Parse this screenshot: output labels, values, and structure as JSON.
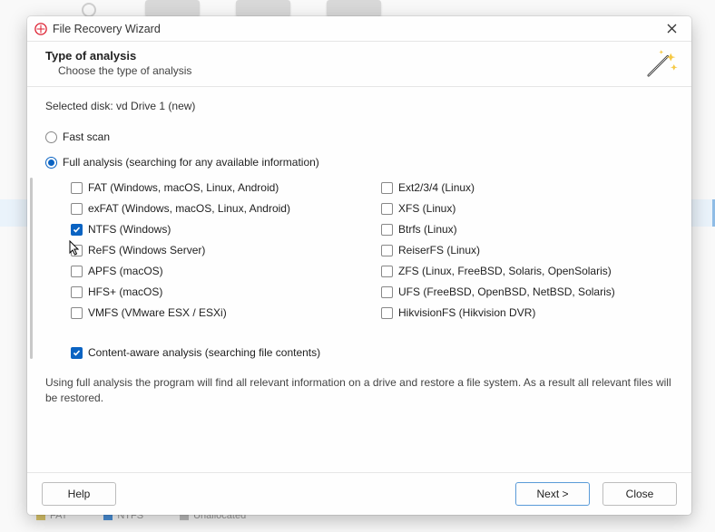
{
  "window": {
    "title": "File Recovery Wizard"
  },
  "header": {
    "title": "Type of analysis",
    "subtitle": "Choose the type of analysis"
  },
  "selected_disk_label": "Selected disk: vd Drive 1 (new)",
  "scan_modes": {
    "fast": {
      "label": "Fast scan",
      "selected": false
    },
    "full": {
      "label": "Full analysis (searching for any available information)",
      "selected": true
    }
  },
  "filesystems": {
    "left": [
      {
        "id": "fat",
        "label": "FAT (Windows, macOS, Linux, Android)",
        "checked": false
      },
      {
        "id": "exfat",
        "label": "exFAT (Windows, macOS, Linux, Android)",
        "checked": false
      },
      {
        "id": "ntfs",
        "label": "NTFS (Windows)",
        "checked": true
      },
      {
        "id": "refs",
        "label": "ReFS (Windows Server)",
        "checked": false
      },
      {
        "id": "apfs",
        "label": "APFS (macOS)",
        "checked": false
      },
      {
        "id": "hfs",
        "label": "HFS+ (macOS)",
        "checked": false
      },
      {
        "id": "vmfs",
        "label": "VMFS (VMware ESX / ESXi)",
        "checked": false
      }
    ],
    "right": [
      {
        "id": "ext",
        "label": "Ext2/3/4 (Linux)",
        "checked": false
      },
      {
        "id": "xfs",
        "label": "XFS (Linux)",
        "checked": false
      },
      {
        "id": "btrfs",
        "label": "Btrfs (Linux)",
        "checked": false
      },
      {
        "id": "reiser",
        "label": "ReiserFS (Linux)",
        "checked": false
      },
      {
        "id": "zfs",
        "label": "ZFS (Linux, FreeBSD, Solaris, OpenSolaris)",
        "checked": false
      },
      {
        "id": "ufs",
        "label": "UFS (FreeBSD, OpenBSD, NetBSD, Solaris)",
        "checked": false
      },
      {
        "id": "hik",
        "label": "HikvisionFS (Hikvision DVR)",
        "checked": false
      }
    ]
  },
  "content_aware": {
    "label": "Content-aware analysis (searching file contents)",
    "checked": true
  },
  "hint": "Using full analysis the program will find all relevant information on a drive and restore a file system. As a result all relevant files will be restored.",
  "buttons": {
    "help": "Help",
    "next": "Next >",
    "close": "Close"
  },
  "bg_status": {
    "fat": "FAT",
    "ntfs": "NTFS",
    "unalloc": "Unallocated"
  }
}
